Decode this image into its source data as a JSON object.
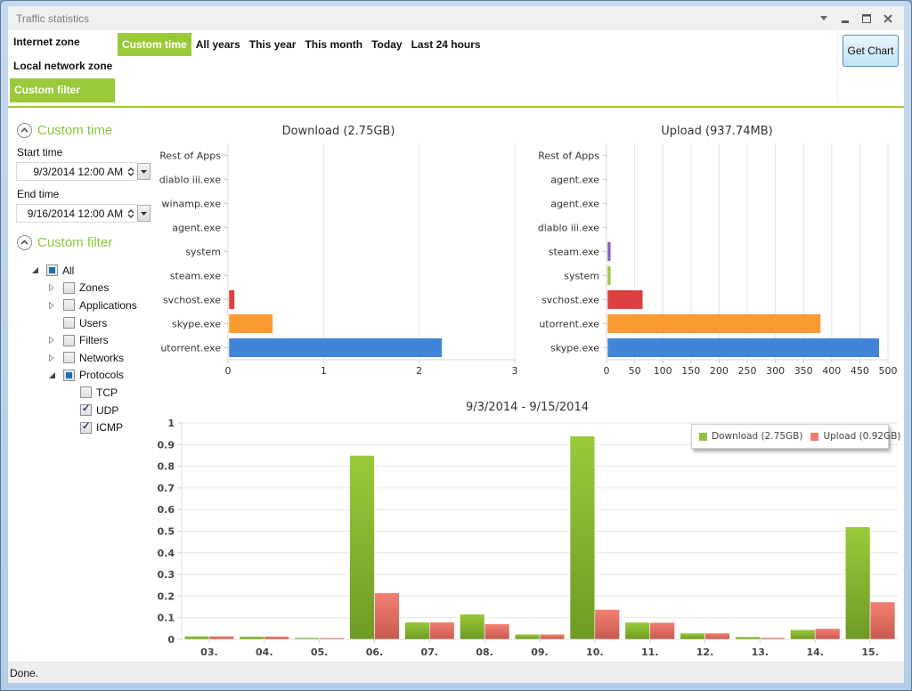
{
  "window": {
    "title": "Traffic statistics",
    "controls": [
      "menu-dropdown",
      "minimize",
      "maximize",
      "close"
    ]
  },
  "zones": [
    {
      "label": "Internet zone",
      "active": false
    },
    {
      "label": "Local network zone",
      "active": false
    },
    {
      "label": "Custom filter",
      "active": true
    }
  ],
  "periods": [
    {
      "label": "Custom time",
      "active": true
    },
    {
      "label": "All years",
      "active": false
    },
    {
      "label": "This year",
      "active": false
    },
    {
      "label": "This month",
      "active": false
    },
    {
      "label": "Today",
      "active": false
    },
    {
      "label": "Last 24 hours",
      "active": false
    }
  ],
  "toolbar": {
    "get_chart_label": "Get Chart"
  },
  "colors": {
    "accent": "#9ac93a",
    "section_title": "#8dc63f"
  },
  "custom_time": {
    "title": "Custom time",
    "start_label": "Start time",
    "start_value": "9/3/2014 12:00 AM",
    "end_label": "End time",
    "end_value": "9/16/2014 12:00 AM"
  },
  "custom_filter": {
    "title": "Custom filter",
    "tree": [
      {
        "label": "All",
        "level": 0,
        "expander": "expanded",
        "state": "partial"
      },
      {
        "label": "Zones",
        "level": 1,
        "expander": "collapsed",
        "state": "unchecked"
      },
      {
        "label": "Applications",
        "level": 1,
        "expander": "collapsed",
        "state": "unchecked"
      },
      {
        "label": "Users",
        "level": 1,
        "expander": "none",
        "state": "unchecked"
      },
      {
        "label": "Filters",
        "level": 1,
        "expander": "collapsed",
        "state": "unchecked"
      },
      {
        "label": "Networks",
        "level": 1,
        "expander": "collapsed",
        "state": "unchecked"
      },
      {
        "label": "Protocols",
        "level": 1,
        "expander": "expanded",
        "state": "partial"
      },
      {
        "label": "TCP",
        "level": 2,
        "expander": "none",
        "state": "unchecked"
      },
      {
        "label": "UDP",
        "level": 2,
        "expander": "none",
        "state": "checked"
      },
      {
        "label": "ICMP",
        "level": 2,
        "expander": "none",
        "state": "checked"
      }
    ]
  },
  "status": {
    "text": "Done."
  },
  "chart_data": [
    {
      "type": "bar",
      "orientation": "horizontal",
      "title": "Download (2.75GB)",
      "categories": [
        "Rest of Apps",
        "diablo iii.exe",
        "winamp.exe",
        "agent.exe",
        "system",
        "steam.exe",
        "svchost.exe",
        "skype.exe",
        "utorrent.exe"
      ],
      "values": [
        0,
        0,
        0,
        0,
        0,
        0,
        0.06,
        0.46,
        2.23
      ],
      "colors": [
        null,
        null,
        null,
        null,
        null,
        null,
        "#dc4040",
        "#fb9a30",
        "#4185d6"
      ],
      "xlabel": "",
      "ylabel": "",
      "xlim": [
        0,
        3
      ],
      "xticks": [
        0,
        1,
        2,
        3
      ],
      "grid": true
    },
    {
      "type": "bar",
      "orientation": "horizontal",
      "title": "Upload (937.74MB)",
      "categories": [
        "Rest of Apps",
        "agent.exe",
        "agent.exe",
        "diablo iii.exe",
        "steam.exe",
        "system",
        "svchost.exe",
        "utorrent.exe",
        "skype.exe"
      ],
      "values": [
        0,
        0,
        0,
        0,
        6,
        6,
        63,
        379,
        483
      ],
      "colors": [
        null,
        null,
        null,
        null,
        "#8a5cc2",
        "#9ac93a",
        "#dc4040",
        "#fb9a30",
        "#4185d6"
      ],
      "xlabel": "",
      "ylabel": "",
      "xlim": [
        0,
        500
      ],
      "xticks": [
        0,
        50,
        100,
        150,
        200,
        250,
        300,
        350,
        400,
        450,
        500
      ],
      "grid": true
    },
    {
      "type": "bar",
      "orientation": "vertical",
      "title": "9/3/2014 - 9/15/2014",
      "categories": [
        "03.",
        "04.",
        "05.",
        "06.",
        "07.",
        "08.",
        "09.",
        "10.",
        "11.",
        "12.",
        "13.",
        "14.",
        "15."
      ],
      "series": [
        {
          "name": "Download (2.75GB)",
          "color": "#8dc63f",
          "values": [
            0.015,
            0.014,
            0.008,
            0.85,
            0.08,
            0.117,
            0.024,
            0.94,
            0.079,
            0.029,
            0.012,
            0.045,
            0.52
          ]
        },
        {
          "name": "Upload (0.92GB)",
          "color": "#f07a6c",
          "values": [
            0.015,
            0.014,
            0.007,
            0.215,
            0.08,
            0.072,
            0.024,
            0.138,
            0.078,
            0.029,
            0.008,
            0.05,
            0.173
          ]
        }
      ],
      "xlabel": "",
      "ylabel": "",
      "ylim": [
        0,
        1
      ],
      "yticks": [
        0,
        0.1,
        0.2,
        0.3,
        0.4,
        0.5,
        0.6,
        0.7,
        0.8,
        0.9,
        1
      ],
      "grid": true,
      "legend": "top-right"
    }
  ]
}
